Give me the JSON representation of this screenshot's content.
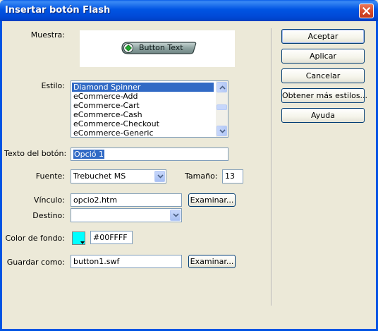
{
  "window": {
    "title": "Insertar botón Flash"
  },
  "preview": {
    "label": "Muestra:",
    "button_text": "Button Text"
  },
  "style": {
    "label": "Estilo:",
    "items": [
      "Diamond Spinner",
      "eCommerce-Add",
      "eCommerce-Cart",
      "eCommerce-Cash",
      "eCommerce-Checkout",
      "eCommerce-Generic"
    ],
    "selected_index": 0
  },
  "button_text_field": {
    "label": "Texto del botón:",
    "value": "Opció 1"
  },
  "font": {
    "label": "Fuente:",
    "value": "Trebuchet MS"
  },
  "size": {
    "label": "Tamaño:",
    "value": "13"
  },
  "link": {
    "label": "Vínculo:",
    "value": "opcio2.htm",
    "browse_label": "Examinar..."
  },
  "target": {
    "label": "Destino:",
    "value": ""
  },
  "bgcolor": {
    "label": "Color de fondo:",
    "value": "#00FFFF",
    "swatch": "#00FFFF"
  },
  "save_as": {
    "label": "Guardar como:",
    "value": "button1.swf",
    "browse_label": "Examinar..."
  },
  "actions": {
    "accept": "Aceptar",
    "apply": "Aplicar",
    "cancel": "Cancelar",
    "more_styles": "Obtener más estilos...",
    "help": "Ayuda"
  },
  "colors": {
    "titlebar": "#0054E3",
    "selection": "#316AC5",
    "dialog_bg": "#ECE9D8"
  }
}
